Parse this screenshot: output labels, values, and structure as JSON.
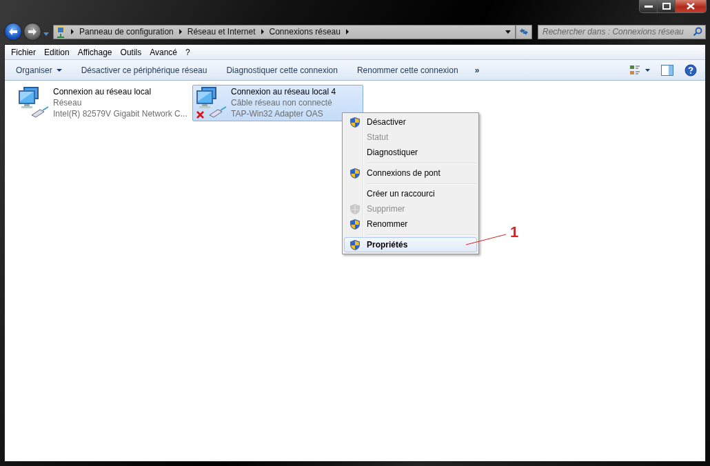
{
  "address_bar": {
    "breadcrumbs": [
      "Panneau de configuration",
      "Réseau et Internet",
      "Connexions réseau"
    ]
  },
  "search": {
    "placeholder": "Rechercher dans : Connexions réseau"
  },
  "menu_bar": [
    "Fichier",
    "Edition",
    "Affichage",
    "Outils",
    "Avancé",
    "?"
  ],
  "command_bar": {
    "items": [
      {
        "label": "Organiser",
        "dropdown": true
      },
      {
        "label": "Désactiver ce périphérique réseau",
        "dropdown": false
      },
      {
        "label": "Diagnostiquer cette connexion",
        "dropdown": false
      },
      {
        "label": "Renommer cette connexion",
        "dropdown": false
      }
    ],
    "overflow": "»"
  },
  "connections": [
    {
      "name": "Connexion au réseau local",
      "status": "Réseau",
      "adapter": "Intel(R) 82579V Gigabit Network C...",
      "selected": false,
      "disconnected": false
    },
    {
      "name": "Connexion au réseau local 4",
      "status": "Câble réseau non connecté",
      "adapter": "TAP-Win32 Adapter OAS",
      "selected": true,
      "disconnected": true
    }
  ],
  "context_menu": [
    {
      "label": "Désactiver",
      "shield": true,
      "disabled": false,
      "default": false,
      "selected": false,
      "separator_after": false
    },
    {
      "label": "Statut",
      "shield": false,
      "disabled": true,
      "default": false,
      "selected": false,
      "separator_after": false
    },
    {
      "label": "Diagnostiquer",
      "shield": false,
      "disabled": false,
      "default": false,
      "selected": false,
      "separator_after": true
    },
    {
      "label": "Connexions de pont",
      "shield": true,
      "disabled": false,
      "default": false,
      "selected": false,
      "separator_after": true
    },
    {
      "label": "Créer un raccourci",
      "shield": false,
      "disabled": false,
      "default": false,
      "selected": false,
      "separator_after": false
    },
    {
      "label": "Supprimer",
      "shield": true,
      "disabled": true,
      "default": false,
      "selected": false,
      "separator_after": false
    },
    {
      "label": "Renommer",
      "shield": true,
      "disabled": false,
      "default": false,
      "selected": false,
      "separator_after": true
    },
    {
      "label": "Propriétés",
      "shield": true,
      "disabled": false,
      "default": true,
      "selected": true,
      "separator_after": false
    }
  ],
  "annotation": {
    "label": "1"
  }
}
